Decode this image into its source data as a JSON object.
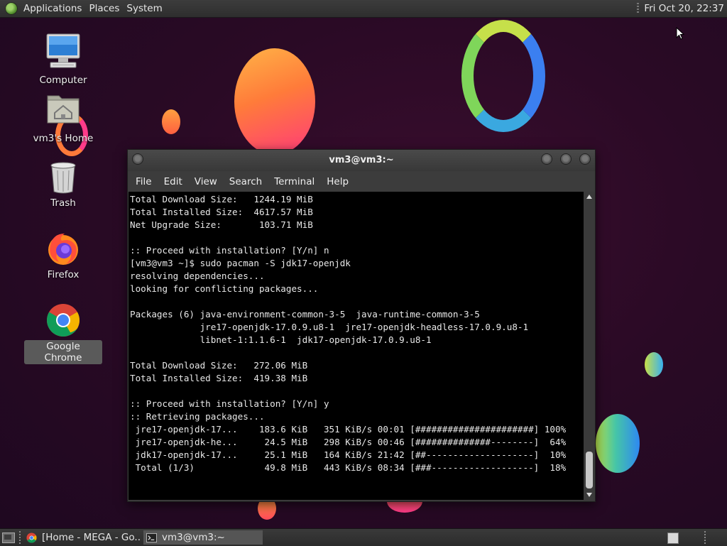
{
  "top_panel": {
    "menus": [
      "Applications",
      "Places",
      "System"
    ],
    "clock": "Fri Oct 20, 22:37"
  },
  "desktop_icons": {
    "computer": "Computer",
    "home": "vm3's Home",
    "trash": "Trash",
    "firefox": "Firefox",
    "chrome": "Google Chrome"
  },
  "terminal": {
    "title": "vm3@vm3:~",
    "menu": [
      "File",
      "Edit",
      "View",
      "Search",
      "Terminal",
      "Help"
    ],
    "lines": [
      "Total Download Size:   1244.19 MiB",
      "Total Installed Size:  4617.57 MiB",
      "Net Upgrade Size:       103.71 MiB",
      "",
      ":: Proceed with installation? [Y/n] n",
      "[vm3@vm3 ~]$ sudo pacman -S jdk17-openjdk",
      "resolving dependencies...",
      "looking for conflicting packages...",
      "",
      "Packages (6) java-environment-common-3-5  java-runtime-common-3-5",
      "             jre17-openjdk-17.0.9.u8-1  jre17-openjdk-headless-17.0.9.u8-1",
      "             libnet-1:1.1.6-1  jdk17-openjdk-17.0.9.u8-1",
      "",
      "Total Download Size:   272.06 MiB",
      "Total Installed Size:  419.38 MiB",
      "",
      ":: Proceed with installation? [Y/n] y",
      ":: Retrieving packages...",
      " jre17-openjdk-17...    183.6 KiB   351 KiB/s 00:01 [######################] 100%",
      " jre17-openjdk-he...     24.5 MiB   298 KiB/s 00:46 [##############--------]  64%",
      " jdk17-openjdk-17...     25.1 MiB   164 KiB/s 21:42 [##--------------------]  10%",
      " Total (1/3)             49.8 MiB   443 KiB/s 08:34 [###-------------------]  18%"
    ]
  },
  "taskbar": {
    "tasks": [
      {
        "label": "[Home - MEGA - Go...",
        "icon": "chrome-icon"
      },
      {
        "label": "vm3@vm3:~",
        "icon": "terminal-icon"
      }
    ]
  },
  "colors": {
    "panel": "#2e2e2e",
    "terminal_bg": "#000000",
    "terminal_fg": "#e8e8e8",
    "desktop_bg": "#2a0a25"
  }
}
